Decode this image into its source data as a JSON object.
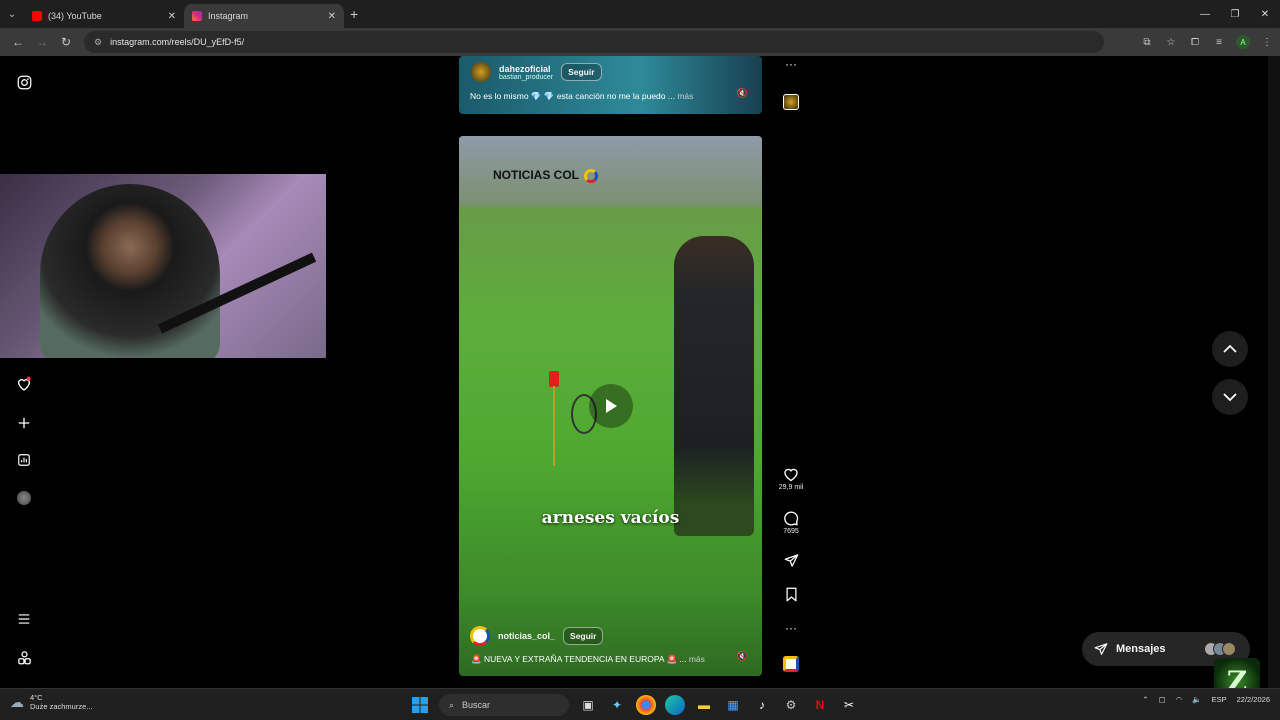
{
  "browser": {
    "tabs": [
      {
        "title": "(34) YouTube",
        "fav_color": "#ff0000",
        "active": false
      },
      {
        "title": "Instagram",
        "fav_color": "#e1306c",
        "active": true
      }
    ],
    "new_tab": "+",
    "url": "instagram.com/reels/DU_yEfD-f5/"
  },
  "reel_top": {
    "username": "dahezoficial",
    "sub_user": "bastian_producer",
    "follow_label": "Seguir",
    "caption": "No es lo mismo 💎 💎 esta canción no me la puedo ...",
    "more_label": "más"
  },
  "reel_main": {
    "watermark": "NOTICIAS COL",
    "subtitle": "arneses vacíos",
    "username": "noticias_col_",
    "follow_label": "Seguir",
    "caption": "🚨 NUEVA Y EXTRAÑA TENDENCIA EN EUROPA 🚨 ...",
    "more_label": "más",
    "likes": "29,9 mil",
    "comments": "7695"
  },
  "messages": {
    "label": "Mensajes"
  },
  "taskbar": {
    "weather_temp": "4°C",
    "weather_desc": "Duże zachmurze...",
    "search_placeholder": "Buscar",
    "lang": "ESP",
    "time": "",
    "date": "22/2/2026"
  },
  "colors": {
    "accent": "#0095f6",
    "background": "#000000"
  }
}
